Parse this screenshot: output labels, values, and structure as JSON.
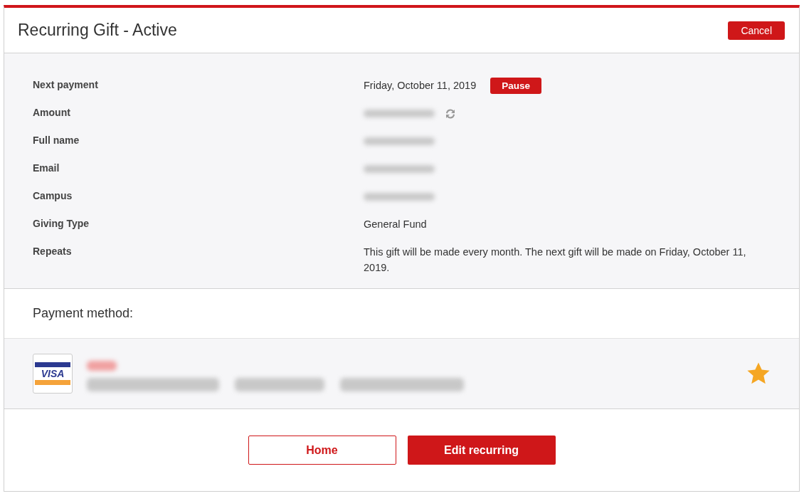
{
  "header": {
    "title": "Recurring Gift - Active",
    "cancel_button": "Cancel"
  },
  "details": [
    {
      "label": "Next payment",
      "kind": "text",
      "value": "Friday, October 11, 2019",
      "button": "Pause"
    },
    {
      "label": "Amount",
      "kind": "redacted",
      "refresh_icon": true
    },
    {
      "label": "Full name",
      "kind": "redacted"
    },
    {
      "label": "Email",
      "kind": "redacted"
    },
    {
      "label": "Campus",
      "kind": "redacted"
    },
    {
      "label": "Giving Type",
      "kind": "text",
      "value": "General Fund"
    },
    {
      "label": "Repeats",
      "kind": "text",
      "value": "This gift will be made every month. The next gift will be made on Friday, October 11, 2019."
    }
  ],
  "payment_method": {
    "heading": "Payment method:",
    "card_logo_text": "VISA",
    "default": true
  },
  "buttons": [
    {
      "label": "Home",
      "kind": "secondary"
    },
    {
      "label": "Edit recurring",
      "kind": "primary"
    }
  ]
}
